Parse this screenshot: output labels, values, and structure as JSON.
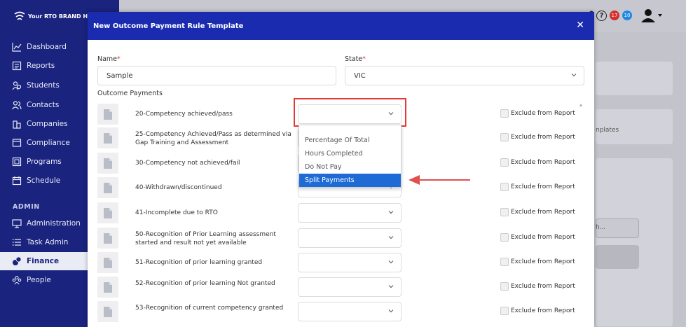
{
  "brand": {
    "name": "Your RTO BRAND HERE"
  },
  "sidebar": {
    "items": [
      {
        "label": "Dashboard",
        "icon": "chart-line-icon"
      },
      {
        "label": "Reports",
        "icon": "report-icon"
      },
      {
        "label": "Students",
        "icon": "students-icon"
      },
      {
        "label": "Contacts",
        "icon": "contacts-icon"
      },
      {
        "label": "Companies",
        "icon": "companies-icon"
      },
      {
        "label": "Compliance",
        "icon": "compliance-icon"
      },
      {
        "label": "Programs",
        "icon": "programs-icon"
      },
      {
        "label": "Schedule",
        "icon": "schedule-icon"
      }
    ],
    "section_admin": "ADMIN",
    "admin_items": [
      {
        "label": "Administration",
        "icon": "monitor-icon"
      },
      {
        "label": "Task Admin",
        "icon": "list-icon"
      },
      {
        "label": "Finance",
        "icon": "finance-icon",
        "active": true
      },
      {
        "label": "People",
        "icon": "people-icon"
      }
    ]
  },
  "header": {
    "help": "?",
    "badge_red": "17",
    "badge_blue": "10"
  },
  "background": {
    "text_templates": "nplates",
    "text_search": "h..."
  },
  "modal": {
    "title": "New Outcome Payment Rule Template",
    "close": "✕",
    "name_label": "Name",
    "name_value": "Sample",
    "state_label": "State",
    "state_value": "VIC",
    "required_mark": "*",
    "section_label": "Outcome Payments",
    "exclude_label": "Exclude from Report",
    "rows": [
      {
        "text": "20-Competency achieved/pass"
      },
      {
        "text": "25-Competency Achieved/Pass as determined via Gap Training and Assessment"
      },
      {
        "text": "30-Competency not achieved/fail"
      },
      {
        "text": "40-Withdrawn/discontinued"
      },
      {
        "text": "41-Incomplete due to RTO"
      },
      {
        "text": "50-Recognition of Prior Learning assessment started and result not yet available"
      },
      {
        "text": "51-Recognition of prior learning granted"
      },
      {
        "text": "52-Recognition of prior learning Not granted"
      },
      {
        "text": "53-Recognition of current competency granted"
      }
    ],
    "dropdown_options": [
      "Percentage Of Total",
      "Hours Completed",
      "Do Not Pay",
      "Split Payments"
    ],
    "dropdown_selected": "Split Payments"
  },
  "colors": {
    "sidebar": "#1a237e",
    "modal_header": "#1a2bb0",
    "highlight": "#e53935",
    "option_selected": "#1e6bd6"
  }
}
